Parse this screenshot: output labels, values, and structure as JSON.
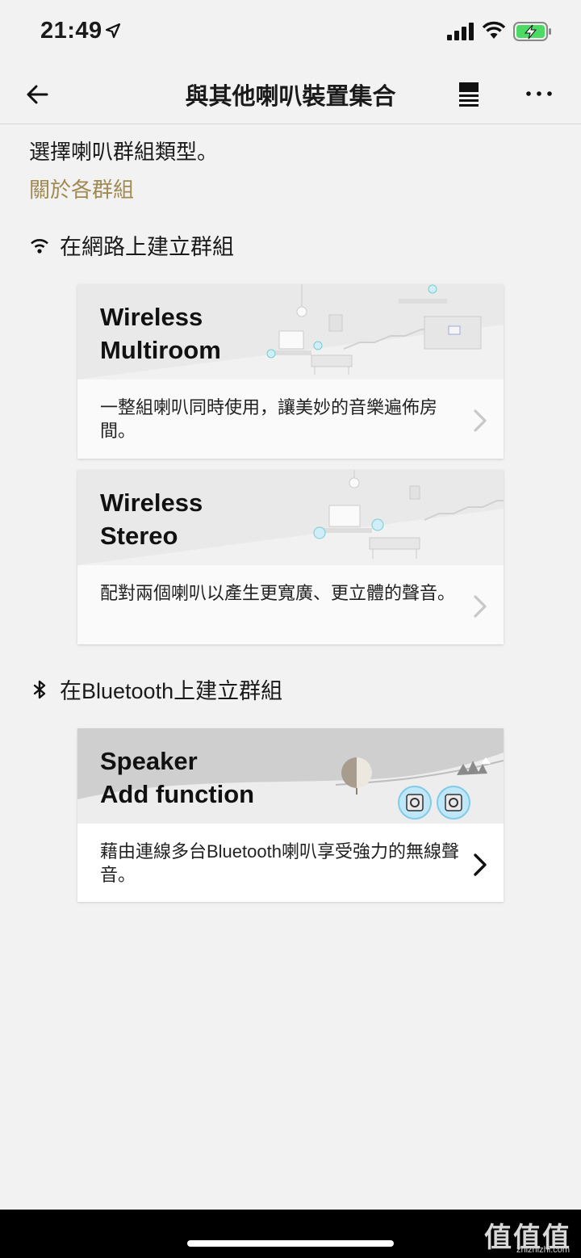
{
  "status_bar": {
    "time": "21:49"
  },
  "nav": {
    "title": "與其他喇叭裝置集合"
  },
  "intro": "選擇喇叭群組類型。",
  "about_link": "關於各群組",
  "sections": [
    {
      "title": "在網路上建立群組",
      "icon": "wifi-icon",
      "cards": [
        {
          "title_line1": "Wireless",
          "title_line2": "Multiroom",
          "description": "一整組喇叭同時使用，讓美妙的音樂遍佈房間。"
        },
        {
          "title_line1": "Wireless",
          "title_line2": "Stereo",
          "description": "配對兩個喇叭以產生更寬廣、更立體的聲音。"
        }
      ]
    },
    {
      "title": "在Bluetooth上建立群組",
      "icon": "bluetooth-icon",
      "cards": [
        {
          "title_line1": "Speaker",
          "title_line2": "Add function",
          "description": "藉由連線多台Bluetooth喇叭享受強力的無線聲音。"
        }
      ]
    }
  ],
  "watermark": {
    "main": "值值值",
    "sub": "zhizhizhi.com"
  },
  "colors": {
    "accent_link": "#a08a52",
    "background": "#f2f2f2",
    "battery_green": "#4cd964",
    "wifi_blue": "#4fc3f7"
  }
}
